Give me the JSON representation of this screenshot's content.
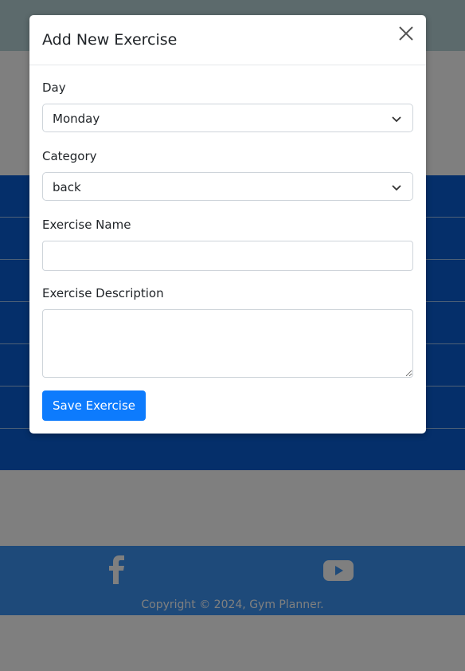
{
  "modal": {
    "title": "Add New Exercise",
    "close_icon": "close-icon",
    "fields": {
      "day": {
        "label": "Day",
        "value": "Monday"
      },
      "category": {
        "label": "Category",
        "value": "back"
      },
      "exercise_name": {
        "label": "Exercise Name",
        "value": "",
        "placeholder": ""
      },
      "exercise_description": {
        "label": "Exercise Description",
        "value": "",
        "placeholder": ""
      }
    },
    "save_label": "Save Exercise"
  },
  "footer": {
    "icons": [
      "facebook-icon",
      "youtube-icon"
    ],
    "copyright": "Copyright © 2024, Gym Planner."
  },
  "colors": {
    "primary": "#0d7bfd",
    "table_blue": "#0a5fd4",
    "footer_blue": "#3d95f5",
    "topbar": "#b9d4d8"
  }
}
